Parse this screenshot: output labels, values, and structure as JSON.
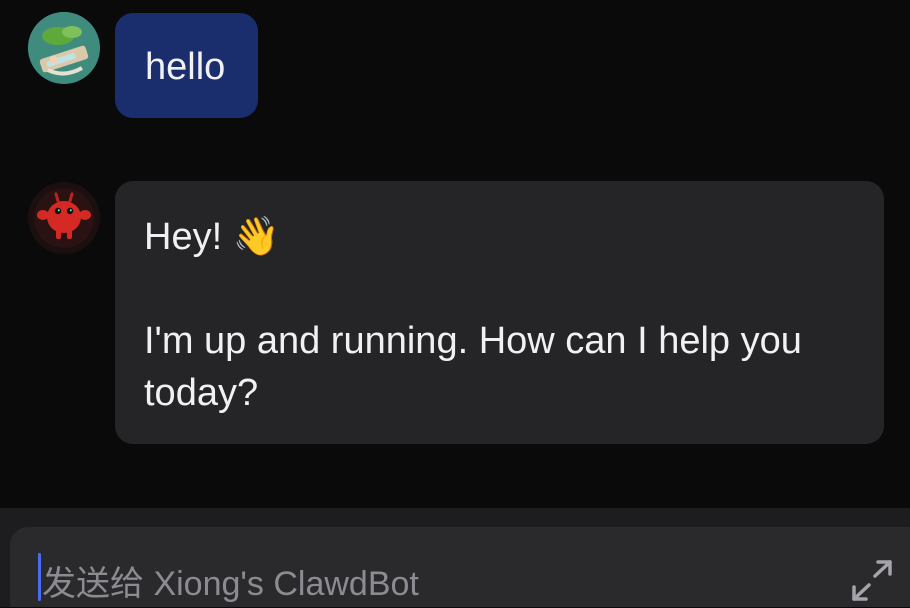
{
  "messages": [
    {
      "role": "user",
      "avatar_icon": "user-avatar-photo",
      "text": "hello",
      "bubble_color": "#1a2d6c"
    },
    {
      "role": "bot",
      "avatar_icon": "red-crab-bot-icon",
      "greeting": "Hey! 👋",
      "body": "I'm up and running. How can I help you today?",
      "bubble_color": "#252527"
    }
  ],
  "composer": {
    "placeholder": "发送给 Xiong's ClawdBot",
    "expand_icon": "expand-arrows-icon"
  },
  "colors": {
    "background": "#0a0a0a",
    "composer_bg": "#2a2a2c",
    "caret": "#4b6cf0",
    "bot_accent": "#d42a23"
  }
}
